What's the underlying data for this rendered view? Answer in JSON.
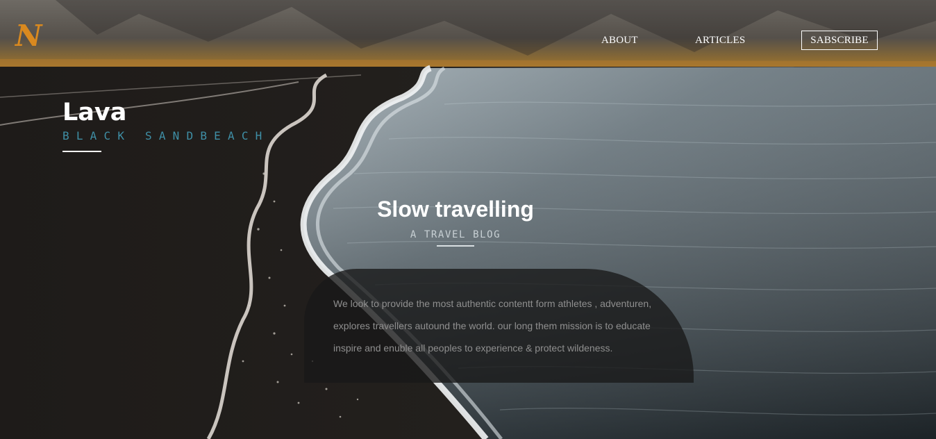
{
  "brand": {
    "logo_letter": "N",
    "logo_color": "#d9891f"
  },
  "nav": {
    "about": "ABOUT",
    "articles": "ARTICLES",
    "subscribe": "SABSCRIBE"
  },
  "hero": {
    "title": "Lava",
    "subtitle": "BLACK SANDBEACH",
    "subtitle_color": "#3f8fa6"
  },
  "center": {
    "title": "Slow travelling",
    "subtitle": "A TRAVEL BLOG"
  },
  "panel": {
    "lines": [
      "We look to provide the most authentic contentt form athletes , adventuren,",
      "explores travellers autound the world. our long them mission is to educate",
      "inspire and enuble all peoples to experience & protect wildeness."
    ]
  }
}
